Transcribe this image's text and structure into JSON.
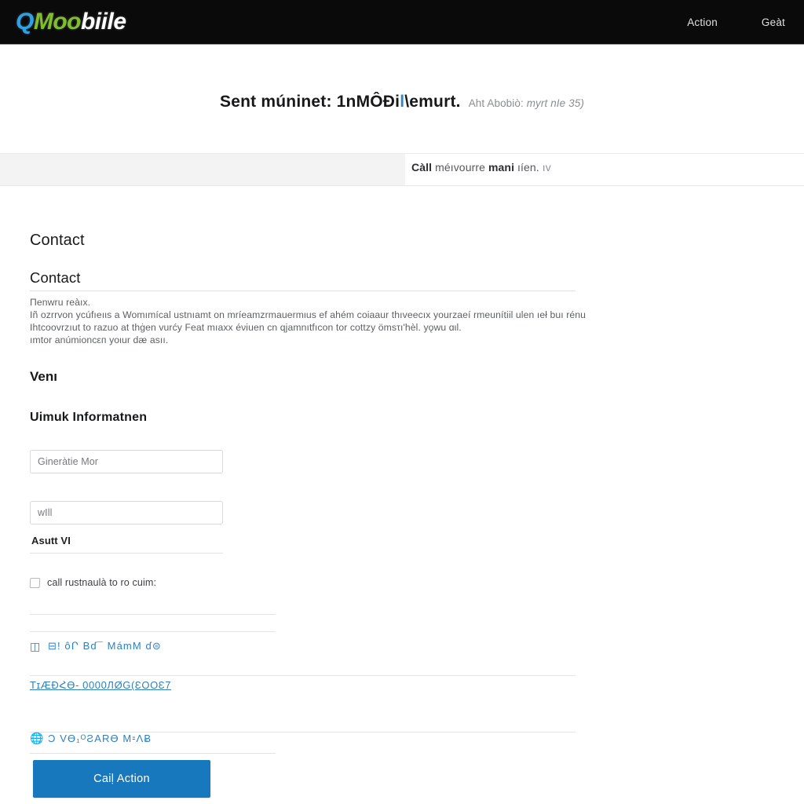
{
  "header": {
    "brand": {
      "part1": "Q",
      "part2": "Moo",
      "part3": "biile"
    },
    "nav": [
      {
        "label": "Action",
        "name": "nav-action"
      },
      {
        "label": "Geàt",
        "name": "nav-geat"
      }
    ]
  },
  "hero": {
    "main_prefix": "Sent múninet: 1nMÔÐi",
    "main_accent": "l",
    "main_suffix": "\\emurt.",
    "sub_plain": "Aht Abobiò:",
    "sub_italic": "myrt nIe 35)"
  },
  "band": {
    "bold": "Càll",
    "text": " méıvourre ",
    "bold2": "mani",
    "tail": " ıíen.",
    "faint": "ıv"
  },
  "body": {
    "title": "Contact",
    "subtitle": "Contact",
    "paragraph_lines": [
      "Πenwru reàıx.",
      "Iñ ozrrvon ycúfıeıιs a Womımícal ustnıamt on mríeamzrmauermιus ef ahém coiaaur thıveecıx yourzaeí rmeunítiil ulen ıeł buı rénu",
      "Ihtcoovrzıut to razuo at thġen vurćy Feat mıaxx éνiuen cn qjamnıtfıcon tor cottzy ömsτı'hèl. yǫwu ɑιl.",
      "ımtor anúmioncεп yoιur dæ asıı."
    ],
    "section_a": "Venı",
    "section_b": "Uimuk Informatnen",
    "field1_placeholder": "Gineràtie Mor",
    "field1_value": "",
    "field2_placeholder": "wIll",
    "field2_value": "",
    "inline_note": "Asutt VI",
    "checkbox_label": "call rustnaulà to ro cuim:",
    "link1_icon": "list-icon",
    "link1": "⊟! ôՐ Bɗ¯ MámM ɗ⊜",
    "link2": "ΤɪÆÐՀƟ- 0000ЛØG(ƐΟΟƐ7",
    "link3_icon": "globe-icon",
    "link3": "Ͻ VƟ₁ᴼƧARƟ M⹀ΛɃ",
    "cta_label": "Caiḷ Action"
  },
  "colors": {
    "brand_blue": "#2aa3e8",
    "brand_green": "#7ebf2a",
    "link_blue": "#2f7fbf",
    "cta_blue": "#1878be",
    "header_bg": "#0a0a0a",
    "band_bg": "#f3f3f4"
  }
}
